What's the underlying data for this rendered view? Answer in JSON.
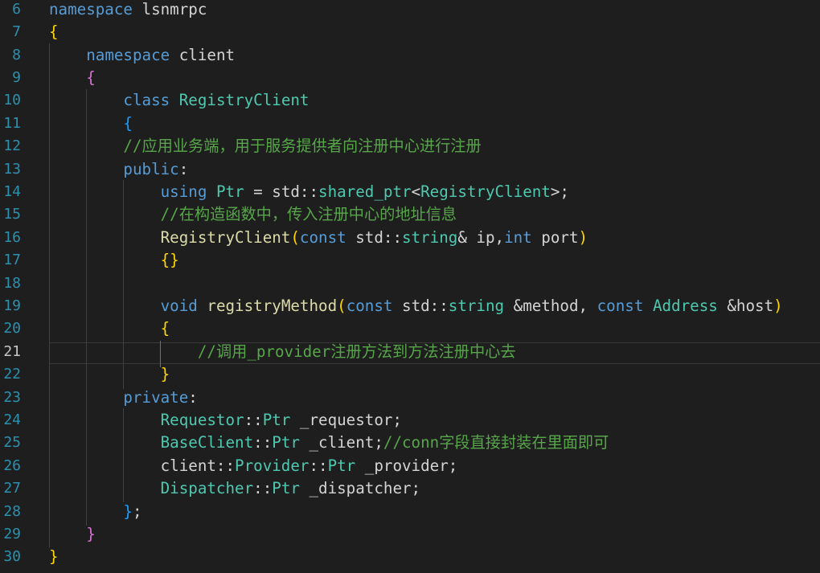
{
  "editor": {
    "lines": [
      {
        "num": "6",
        "tokens": [
          {
            "c": "kw",
            "t": "namespace"
          },
          {
            "c": "pn",
            "t": " lsnmrpc"
          }
        ]
      },
      {
        "num": "7",
        "tokens": [
          {
            "c": "br1",
            "t": "{"
          }
        ]
      },
      {
        "num": "8",
        "tokens": [
          {
            "c": "pn",
            "t": "    "
          },
          {
            "c": "kw",
            "t": "namespace"
          },
          {
            "c": "pn",
            "t": " client"
          }
        ]
      },
      {
        "num": "9",
        "tokens": [
          {
            "c": "pn",
            "t": "    "
          },
          {
            "c": "br2",
            "t": "{"
          }
        ]
      },
      {
        "num": "10",
        "tokens": [
          {
            "c": "pn",
            "t": "        "
          },
          {
            "c": "kw",
            "t": "class"
          },
          {
            "c": "pn",
            "t": " "
          },
          {
            "c": "ty",
            "t": "RegistryClient"
          }
        ]
      },
      {
        "num": "11",
        "tokens": [
          {
            "c": "pn",
            "t": "        "
          },
          {
            "c": "br3",
            "t": "{"
          }
        ]
      },
      {
        "num": "12",
        "tokens": [
          {
            "c": "pn",
            "t": "        "
          },
          {
            "c": "cm",
            "t": "//应用业务端，用于服务提供者向注册中心进行注册"
          }
        ]
      },
      {
        "num": "13",
        "tokens": [
          {
            "c": "pn",
            "t": "        "
          },
          {
            "c": "kw",
            "t": "public"
          },
          {
            "c": "pn",
            "t": ":"
          }
        ]
      },
      {
        "num": "14",
        "tokens": [
          {
            "c": "pn",
            "t": "            "
          },
          {
            "c": "kw",
            "t": "using"
          },
          {
            "c": "pn",
            "t": " "
          },
          {
            "c": "ty",
            "t": "Ptr"
          },
          {
            "c": "op",
            "t": " = "
          },
          {
            "c": "pn",
            "t": "std::"
          },
          {
            "c": "ty",
            "t": "shared_ptr"
          },
          {
            "c": "pn",
            "t": "<"
          },
          {
            "c": "ty",
            "t": "RegistryClient"
          },
          {
            "c": "pn",
            "t": ">;"
          }
        ]
      },
      {
        "num": "15",
        "tokens": [
          {
            "c": "pn",
            "t": "            "
          },
          {
            "c": "cm",
            "t": "//在构造函数中，传入注册中心的地址信息"
          }
        ]
      },
      {
        "num": "16",
        "tokens": [
          {
            "c": "pn",
            "t": "            "
          },
          {
            "c": "fn",
            "t": "RegistryClient"
          },
          {
            "c": "br1",
            "t": "("
          },
          {
            "c": "kw",
            "t": "const"
          },
          {
            "c": "pn",
            "t": " std::"
          },
          {
            "c": "ty",
            "t": "string"
          },
          {
            "c": "pn",
            "t": "& ip,"
          },
          {
            "c": "kw",
            "t": "int"
          },
          {
            "c": "pn",
            "t": " port"
          },
          {
            "c": "br1",
            "t": ")"
          }
        ]
      },
      {
        "num": "17",
        "tokens": [
          {
            "c": "pn",
            "t": "            "
          },
          {
            "c": "br1",
            "t": "{}"
          }
        ]
      },
      {
        "num": "18",
        "tokens": []
      },
      {
        "num": "19",
        "tokens": [
          {
            "c": "pn",
            "t": "            "
          },
          {
            "c": "kw",
            "t": "void"
          },
          {
            "c": "pn",
            "t": " "
          },
          {
            "c": "fn",
            "t": "registryMethod"
          },
          {
            "c": "br1",
            "t": "("
          },
          {
            "c": "kw",
            "t": "const"
          },
          {
            "c": "pn",
            "t": " std::"
          },
          {
            "c": "ty",
            "t": "string"
          },
          {
            "c": "pn",
            "t": " &method, "
          },
          {
            "c": "kw",
            "t": "const"
          },
          {
            "c": "pn",
            "t": " "
          },
          {
            "c": "ty",
            "t": "Address"
          },
          {
            "c": "pn",
            "t": " &host"
          },
          {
            "c": "br1",
            "t": ")"
          }
        ]
      },
      {
        "num": "20",
        "tokens": [
          {
            "c": "pn",
            "t": "            "
          },
          {
            "c": "br1",
            "t": "{"
          }
        ]
      },
      {
        "num": "21",
        "tokens": [
          {
            "c": "pn",
            "t": "                "
          },
          {
            "c": "cm",
            "t": "//调用_provider注册方法到方法注册中心去"
          }
        ]
      },
      {
        "num": "22",
        "tokens": [
          {
            "c": "pn",
            "t": "            "
          },
          {
            "c": "br1",
            "t": "}"
          }
        ]
      },
      {
        "num": "23",
        "tokens": [
          {
            "c": "pn",
            "t": "        "
          },
          {
            "c": "kw",
            "t": "private"
          },
          {
            "c": "pn",
            "t": ":"
          }
        ]
      },
      {
        "num": "24",
        "tokens": [
          {
            "c": "pn",
            "t": "            "
          },
          {
            "c": "ty",
            "t": "Requestor"
          },
          {
            "c": "pn",
            "t": "::"
          },
          {
            "c": "ty",
            "t": "Ptr"
          },
          {
            "c": "pn",
            "t": " _requestor;"
          }
        ]
      },
      {
        "num": "25",
        "tokens": [
          {
            "c": "pn",
            "t": "            "
          },
          {
            "c": "ty",
            "t": "BaseClient"
          },
          {
            "c": "pn",
            "t": "::"
          },
          {
            "c": "ty",
            "t": "Ptr"
          },
          {
            "c": "pn",
            "t": " _client;"
          },
          {
            "c": "cm",
            "t": "//conn字段直接封装在里面即可"
          }
        ]
      },
      {
        "num": "26",
        "tokens": [
          {
            "c": "pn",
            "t": "            client::"
          },
          {
            "c": "ty",
            "t": "Provider"
          },
          {
            "c": "pn",
            "t": "::"
          },
          {
            "c": "ty",
            "t": "Ptr"
          },
          {
            "c": "pn",
            "t": " _provider;"
          }
        ]
      },
      {
        "num": "27",
        "tokens": [
          {
            "c": "pn",
            "t": "            "
          },
          {
            "c": "ty",
            "t": "Dispatcher"
          },
          {
            "c": "pn",
            "t": "::"
          },
          {
            "c": "ty",
            "t": "Ptr"
          },
          {
            "c": "pn",
            "t": " _dispatcher;"
          }
        ]
      },
      {
        "num": "28",
        "tokens": [
          {
            "c": "pn",
            "t": "        "
          },
          {
            "c": "br3",
            "t": "}"
          },
          {
            "c": "pn",
            "t": ";"
          }
        ]
      },
      {
        "num": "29",
        "tokens": [
          {
            "c": "pn",
            "t": "    "
          },
          {
            "c": "br2",
            "t": "}"
          }
        ]
      },
      {
        "num": "30",
        "tokens": [
          {
            "c": "br1",
            "t": "}"
          }
        ]
      }
    ],
    "active_line": "21"
  }
}
